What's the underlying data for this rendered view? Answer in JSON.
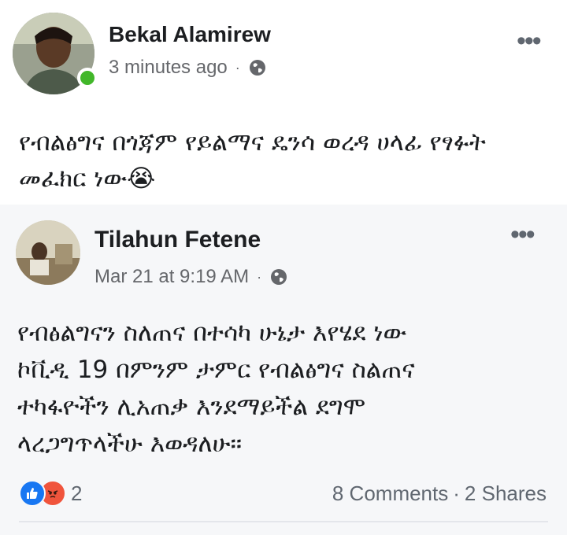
{
  "post": {
    "author": "Bekal Alamirew",
    "time": "3 minutes ago",
    "meta_separator": "·",
    "privacy_icon": "globe-icon",
    "more_icon": "•••",
    "text_line1": "የብልፅግና በጎጃም የይልማና ዴንሳ ወረዳ ሀላፊ የፃፉት",
    "text_line2": "መፈክር ነው",
    "emoji": "😭"
  },
  "shared_post": {
    "author": "Tilahun Fetene",
    "time": "Mar 21 at 9:19 AM",
    "meta_separator": "·",
    "privacy_icon": "globe-icon",
    "more_icon": "•••",
    "lines": [
      "የብፅልግናን ስለጠና በተሳካ ሁኔታ እየሄደ ነው",
      "ኮቪዲ 19 በምንም ታምር የብልፅግና ስልጠና",
      "ተካፋዮችን ሊአጠቃ እንደማይችል ደግሞ",
      "ላረጋግጥላችሁ እወዳለሁ።"
    ]
  },
  "footer": {
    "reaction_count": "2",
    "comments": "8 Comments",
    "separator": "·",
    "shares": "2 Shares"
  },
  "colors": {
    "online": "#42b72a",
    "like": "#1877f2",
    "angry": "#f0543c",
    "secondary_text": "#65676b"
  }
}
